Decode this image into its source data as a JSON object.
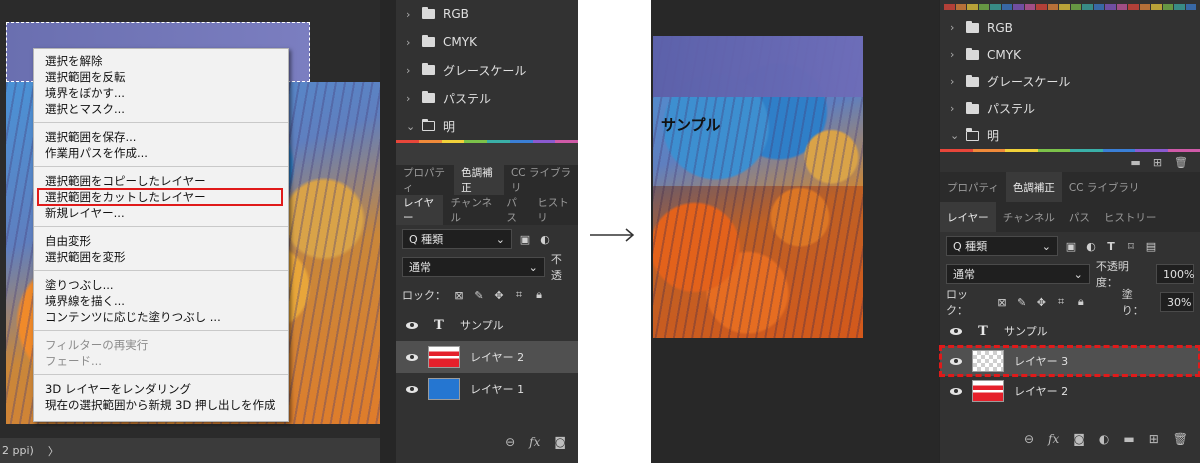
{
  "left": {
    "context_menu": {
      "groups": [
        [
          "選択を解除",
          "選択範囲を反転",
          "境界をぼかす...",
          "選択とマスク..."
        ],
        [
          "選択範囲を保存...",
          "作業用パスを作成..."
        ],
        [
          "選択範囲をコピーしたレイヤー",
          "選択範囲をカットしたレイヤー",
          "新規レイヤー..."
        ],
        [
          "自由変形",
          "選択範囲を変形"
        ],
        [
          "塗りつぶし...",
          "境界線を描く...",
          "コンテンツに応じた塗りつぶし ..."
        ],
        [
          "フィルターの再実行",
          "フェード..."
        ],
        [
          "3D レイヤーをレンダリング",
          "現在の選択範囲から新規 3D 押し出しを作成"
        ]
      ],
      "highlighted": "選択範囲をカットしたレイヤー"
    },
    "status_bar": {
      "zoom_text": "2 ppi)",
      "arrow": "〉"
    },
    "panel": {
      "folders": [
        {
          "label": "RGB"
        },
        {
          "label": "CMYK"
        },
        {
          "label": "グレースケール"
        },
        {
          "label": "パステル"
        },
        {
          "label": "明"
        }
      ],
      "panel_tabs": [
        "プロパティ",
        "色調補正",
        "CC ライブラリ"
      ],
      "layer_tabs": [
        "レイヤー",
        "チャンネル",
        "パス",
        "ヒストリ"
      ],
      "filter_label": "Q 種類",
      "blend_mode": "通常",
      "opacity_label": "不透",
      "lock_label": "ロック：",
      "layers": [
        {
          "name": "サンプル",
          "type": "text"
        },
        {
          "name": "レイヤー 2",
          "type": "red",
          "selected": true
        },
        {
          "name": "レイヤー 1",
          "type": "blue"
        }
      ]
    }
  },
  "right": {
    "canvas_text": "サンプル",
    "panel": {
      "folders": [
        {
          "label": "RGB"
        },
        {
          "label": "CMYK"
        },
        {
          "label": "グレースケール"
        },
        {
          "label": "パステル"
        },
        {
          "label": "明"
        }
      ],
      "panel_tabs": [
        "プロパティ",
        "色調補正",
        "CC ライブラリ"
      ],
      "layer_tabs": [
        "レイヤー",
        "チャンネル",
        "パス",
        "ヒストリー"
      ],
      "filter_label": "Q 種類",
      "blend_mode": "通常",
      "opacity_label": "不透明度：",
      "opacity_value": "100%",
      "lock_label": "ロック：",
      "fill_label": "塗り：",
      "fill_value": "30%",
      "layers": [
        {
          "name": "サンプル",
          "type": "text"
        },
        {
          "name": "レイヤー 3",
          "type": "check",
          "selected": true
        },
        {
          "name": "レイヤー 2",
          "type": "red"
        }
      ]
    }
  },
  "colors": {
    "highlight_red": "#e01a1a",
    "panel_bg": "#323232",
    "swatches": [
      "#e8463a",
      "#f08a3a",
      "#f2d13a",
      "#7cc24a",
      "#3ab0a8",
      "#3a7fd6",
      "#8a5ad0",
      "#d05aa8"
    ]
  }
}
